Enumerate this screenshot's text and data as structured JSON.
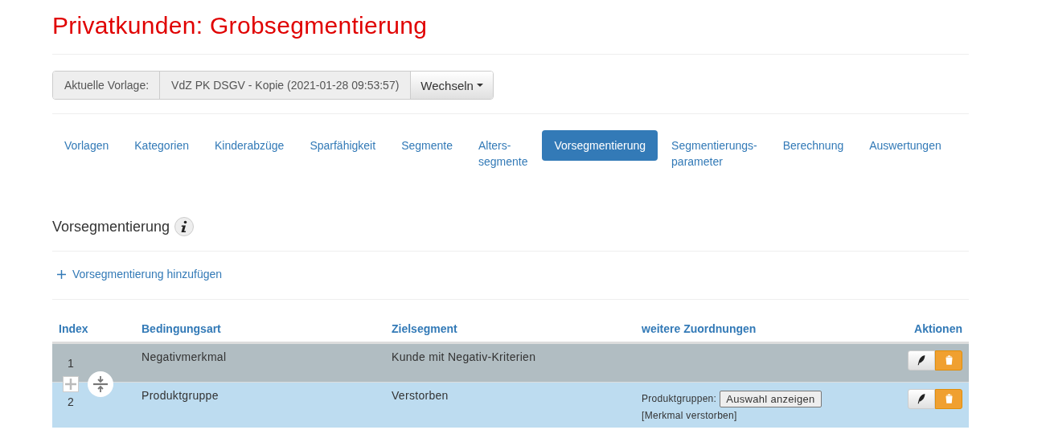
{
  "title": "Privatkunden: Grobsegmentierung",
  "template": {
    "label": "Aktuelle Vorlage:",
    "value": "VdZ PK DSGV - Kopie (2021-01-28 09:53:57)",
    "button": "Wechseln"
  },
  "tabs": [
    {
      "label": "Vorlagen",
      "selected": false
    },
    {
      "label": "Kategorien",
      "selected": false
    },
    {
      "label": "Kinderabzüge",
      "selected": false
    },
    {
      "label": "Sparfähigkeit",
      "selected": false
    },
    {
      "label": "Segmente",
      "selected": false
    },
    {
      "label": "Alters-\nsegmente",
      "selected": false
    },
    {
      "label": "Vorsegmentierung",
      "selected": true
    },
    {
      "label": "Segmentierungs-\nparameter",
      "selected": false
    },
    {
      "label": "Berechnung",
      "selected": false
    },
    {
      "label": "Auswertungen",
      "selected": false
    }
  ],
  "section": {
    "heading": "Vorsegmentierung",
    "add_link": "Vorsegmentierung hinzufügen"
  },
  "table": {
    "columns": [
      "Index",
      "Bedingungsart",
      "Zielsegment",
      "weitere Zuordnungen",
      "Aktionen"
    ],
    "rows": [
      {
        "index": "1",
        "condition": "Negativmerkmal",
        "target": "Kunde mit Negativ-Kriterien",
        "color": "#b1bdc2"
      },
      {
        "index": "2",
        "condition": "Produktgruppe",
        "target": "Verstorben",
        "color": "#bddcf0",
        "extra": {
          "label": "Produktgruppen:",
          "button": "Auswahl anzeigen",
          "note": "[Merkmal verstorben]"
        }
      }
    ]
  }
}
